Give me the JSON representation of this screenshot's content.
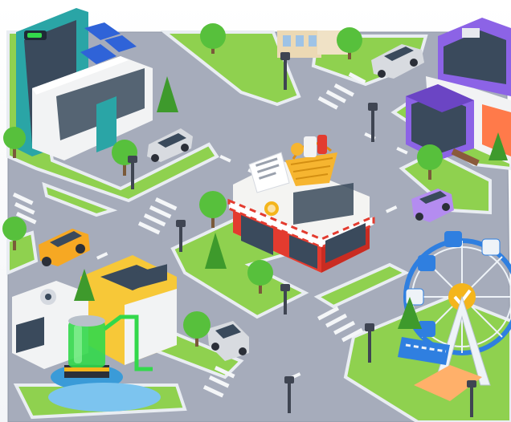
{
  "scene": {
    "description_icon": "isometric-city-icon",
    "colors": {
      "background": "#ffffff",
      "road": "#a6acbb",
      "road_edge": "#8f96a6",
      "road_marking": "#f4f6f8",
      "grass": "#8fd14f",
      "grass_dark": "#6fb53a",
      "curb": "#e9edf2",
      "tree": "#57c03c",
      "tree_dark": "#3e9a2c",
      "store_red": "#e33b2f",
      "store_white": "#f4f4f2",
      "basket": "#f6b530",
      "sign_orange": "#ff8a1e",
      "house_white": "#f2f3f4",
      "house_teal": "#2aa5a6",
      "solar": "#2f63d8",
      "purple_building": "#8c63e6",
      "purple_car": "#b48cf0",
      "yellow_car": "#f6a823",
      "silver_car": "#d8dbe0",
      "factory_yellow": "#f7c838",
      "tank_green": "#33d84b",
      "ferris_blue": "#2f7fe0",
      "ferris_white": "#eef3f8",
      "coin_gold": "#f4b51c",
      "lamp": "#3f4552"
    }
  }
}
